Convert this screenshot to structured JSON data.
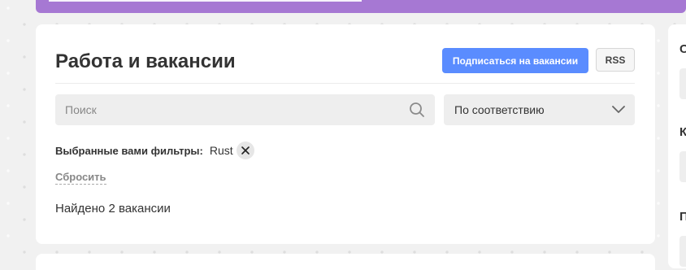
{
  "banner": {
    "color": "#a678d3"
  },
  "header": {
    "title": "Работа и вакансии",
    "subscribe_label": "Подписаться на вакансии",
    "rss_label": "RSS",
    "accent": "#5a8cff"
  },
  "search": {
    "placeholder": "Поиск",
    "value": ""
  },
  "sort": {
    "selected": "По соответствию"
  },
  "filters": {
    "label": "Выбранные вами фильтры:",
    "chips": [
      {
        "label": "Rust"
      }
    ],
    "reset_label": "Сбросить"
  },
  "results": {
    "count_text": "Найдено 2 вакансии"
  },
  "right_panel": {
    "letters": [
      "С",
      "К",
      "П"
    ]
  },
  "icons": {
    "search": "search-icon",
    "sort": "chevron-down-icon",
    "remove": "close-icon"
  }
}
